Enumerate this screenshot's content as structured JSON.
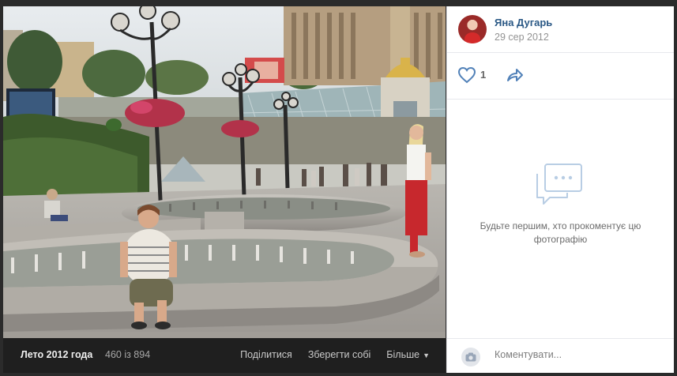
{
  "header": {
    "author_name": "Яна Дугарь",
    "date": "29 сер 2012",
    "avatar_icon": "user-avatar"
  },
  "reactions": {
    "like_count": "1",
    "like_icon": "heart-outline-icon",
    "share_icon": "share-arrow-icon"
  },
  "comments": {
    "empty_message": "Будьте першим, хто прокоментує цю фотографію",
    "empty_icon": "speech-bubble-icon",
    "input_placeholder": "Коментувати...",
    "camera_icon": "camera-icon"
  },
  "photo_bar": {
    "album_title": "Лето 2012 года",
    "counter": "460 із 894",
    "share_label": "Поділитися",
    "save_label": "Зберегти собі",
    "more_label": "Більше"
  },
  "colors": {
    "link_blue": "#2a5885",
    "icon_blue": "#5181b8",
    "bar_bg": "#1f1f1f"
  }
}
